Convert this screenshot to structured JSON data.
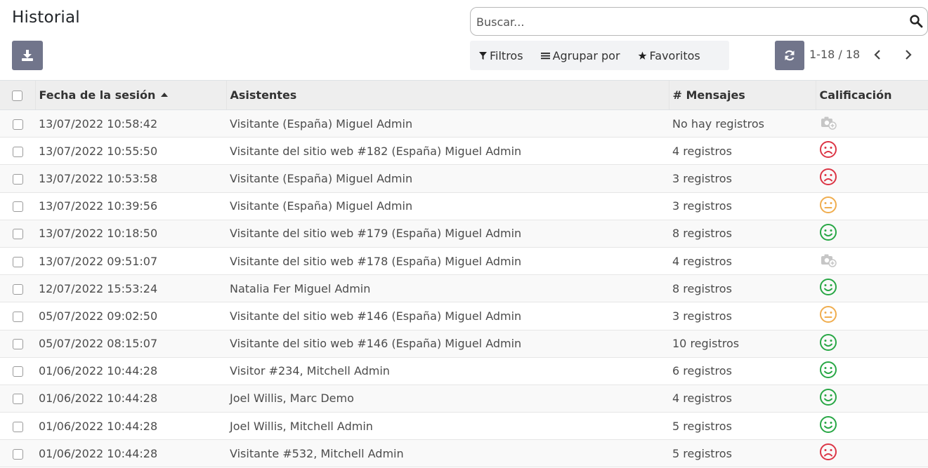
{
  "header": {
    "title": "Historial",
    "search_placeholder": "Buscar...",
    "filters_label": "Filtros",
    "group_label": "Agrupar por",
    "favorites_label": "Favoritos",
    "pager": "1-18 / 18"
  },
  "table": {
    "columns": [
      "Fecha de la sesión",
      "Asistentes",
      "# Mensajes",
      "Calificación"
    ],
    "rows": [
      {
        "date": "13/07/2022 10:58:42",
        "attendees": "Visitante (España) Miguel Admin",
        "messages": "No hay registros",
        "rating": "none"
      },
      {
        "date": "13/07/2022 10:55:50",
        "attendees": "Visitante del sitio web #182 (España) Miguel Admin",
        "messages": "4 registros",
        "rating": "sad"
      },
      {
        "date": "13/07/2022 10:53:58",
        "attendees": "Visitante (España) Miguel Admin",
        "messages": "3 registros",
        "rating": "sad"
      },
      {
        "date": "13/07/2022 10:39:56",
        "attendees": "Visitante (España) Miguel Admin",
        "messages": "3 registros",
        "rating": "neutral"
      },
      {
        "date": "13/07/2022 10:18:50",
        "attendees": "Visitante del sitio web #179 (España) Miguel Admin",
        "messages": "8 registros",
        "rating": "happy"
      },
      {
        "date": "13/07/2022 09:51:07",
        "attendees": "Visitante del sitio web #178 (España) Miguel Admin",
        "messages": "4 registros",
        "rating": "none"
      },
      {
        "date": "12/07/2022 15:53:24",
        "attendees": "Natalia Fer Miguel Admin",
        "messages": "8 registros",
        "rating": "happy"
      },
      {
        "date": "05/07/2022 09:02:50",
        "attendees": "Visitante del sitio web #146 (España) Miguel Admin",
        "messages": "3 registros",
        "rating": "neutral"
      },
      {
        "date": "05/07/2022 08:15:07",
        "attendees": "Visitante del sitio web #146 (España) Miguel Admin",
        "messages": "10 registros",
        "rating": "happy"
      },
      {
        "date": "01/06/2022 10:44:28",
        "attendees": "Visitor #234, Mitchell Admin",
        "messages": "6 registros",
        "rating": "happy"
      },
      {
        "date": "01/06/2022 10:44:28",
        "attendees": "Joel Willis, Marc Demo",
        "messages": "4 registros",
        "rating": "happy"
      },
      {
        "date": "01/06/2022 10:44:28",
        "attendees": "Joel Willis, Mitchell Admin",
        "messages": "5 registros",
        "rating": "happy"
      },
      {
        "date": "01/06/2022 10:44:28",
        "attendees": "Visitante #532, Mitchell Admin",
        "messages": "5 registros",
        "rating": "sad"
      }
    ]
  },
  "colors": {
    "button_bg": "#71758b",
    "happy": "#28a745",
    "sad": "#dc3545",
    "neutral": "#f0ad4e",
    "none": "#c6c6c6"
  }
}
